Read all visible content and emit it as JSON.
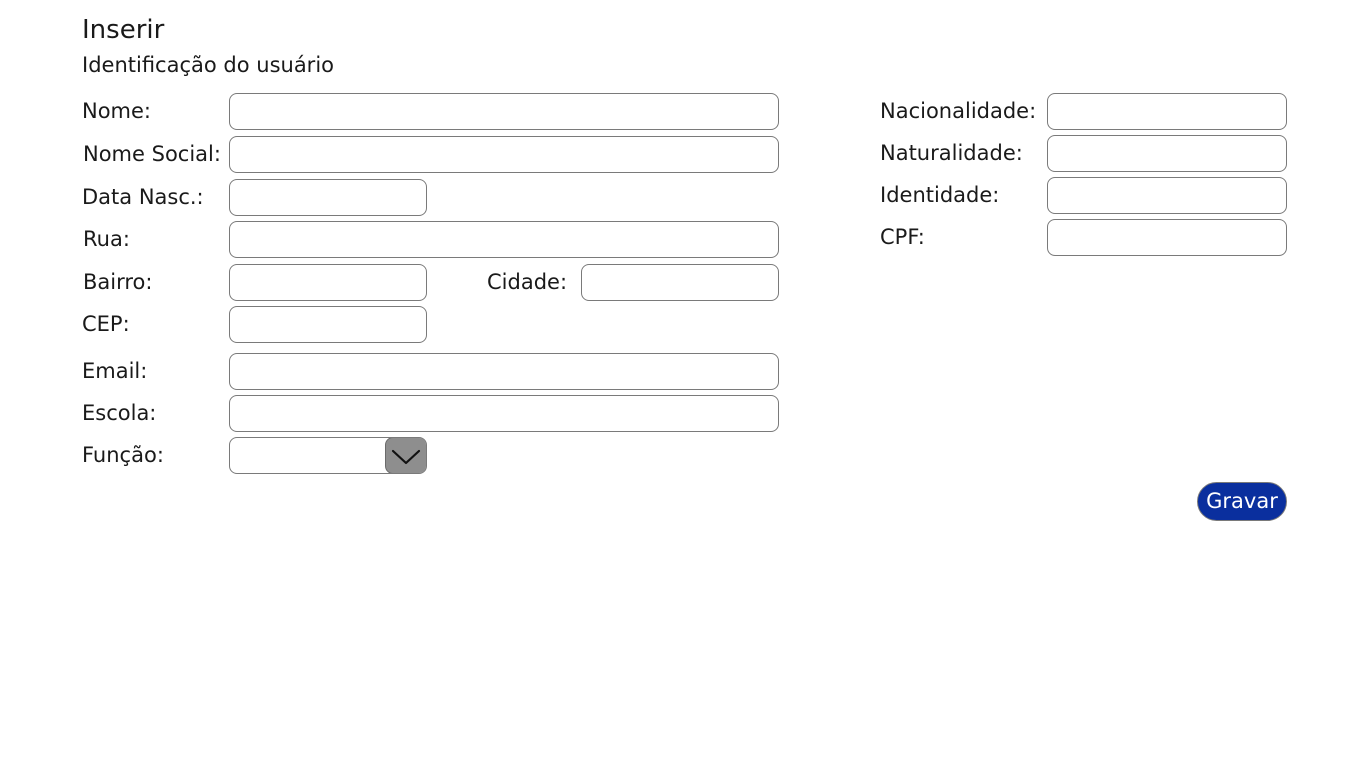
{
  "header": {
    "title": "Inserir",
    "subtitle": "Identificação do usuário"
  },
  "form": {
    "nome": {
      "label": "Nome:",
      "value": ""
    },
    "nome_social": {
      "label": "Nome Social:",
      "value": ""
    },
    "data_nasc": {
      "label": "Data Nasc.:",
      "value": ""
    },
    "rua": {
      "label": "Rua:",
      "value": ""
    },
    "bairro": {
      "label": "Bairro:",
      "value": ""
    },
    "cidade": {
      "label": "Cidade:",
      "value": ""
    },
    "cep": {
      "label": "CEP:",
      "value": ""
    },
    "email": {
      "label": "Email:",
      "value": ""
    },
    "escola": {
      "label": "Escola:",
      "value": ""
    },
    "funcao": {
      "label": "Função:",
      "value": ""
    },
    "nacionalidade": {
      "label": "Nacionalidade:",
      "value": ""
    },
    "naturalidade": {
      "label": "Naturalidade:",
      "value": ""
    },
    "identidade": {
      "label": "Identidade:",
      "value": ""
    },
    "cpf": {
      "label": "CPF:",
      "value": ""
    }
  },
  "actions": {
    "save_label": "Gravar"
  },
  "colors": {
    "save_button_bg": "#0a2f9e",
    "dropdown_button_bg": "#8e8e8e",
    "field_border": "#7a7a7a"
  },
  "icons": {
    "dropdown": "chevron-down-icon"
  }
}
